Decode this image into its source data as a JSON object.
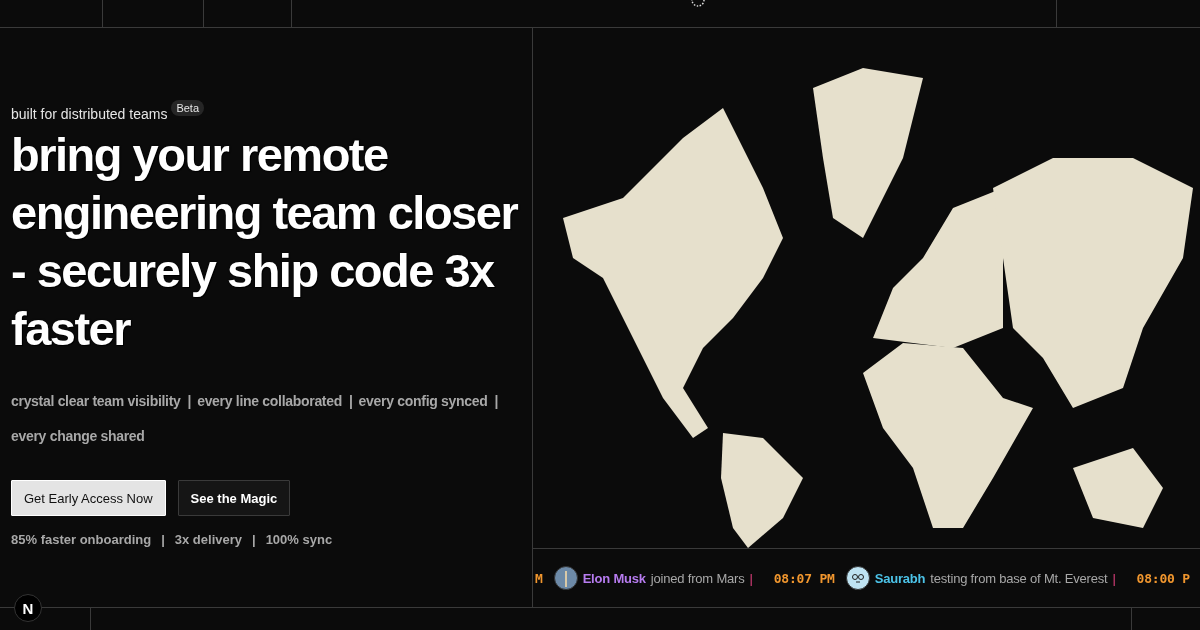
{
  "eyebrow": {
    "text": "built for distributed teams",
    "badge": "Beta"
  },
  "headline": "bring your remote engineering team closer - securely ship code 3x faster",
  "taglines": {
    "separator": "|",
    "items": [
      "crystal clear team visibility",
      "every line collaborated",
      "every config synced",
      "every change shared"
    ]
  },
  "buttons": [
    {
      "label": "Get Early Access Now",
      "kind": "primary"
    },
    {
      "label": "See the Magic",
      "kind": "secondary"
    }
  ],
  "stats": {
    "separator": "|",
    "items": [
      "85% faster onboarding",
      "3x delivery",
      "100% sync"
    ]
  },
  "feed": {
    "separator": "|",
    "items": [
      {
        "kind": "time",
        "text": "M"
      },
      {
        "kind": "photo",
        "name": "Elon Musk",
        "color": "#b77cf0",
        "text": "joined from Mars"
      },
      {
        "kind": "time",
        "text": "08:07 PM"
      },
      {
        "kind": "cartoon",
        "name": "Saurabh",
        "color": "#4cc3e8",
        "text": "testing from base of Mt. Everest"
      },
      {
        "kind": "time",
        "text": "08:00 P"
      }
    ]
  },
  "logo": "N"
}
